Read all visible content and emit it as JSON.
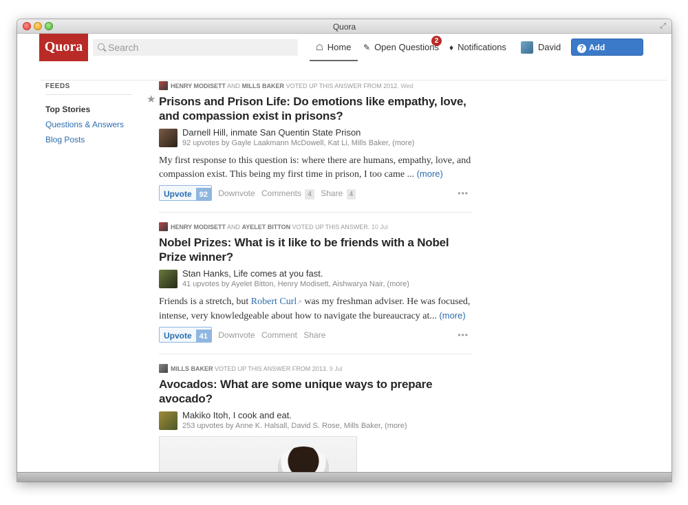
{
  "window": {
    "title": "Quora"
  },
  "header": {
    "logo": "Quora",
    "search_placeholder": "Search",
    "nav": {
      "home": "Home",
      "open_questions": "Open Questions",
      "open_questions_badge": "2",
      "notifications": "Notifications",
      "user": "David"
    },
    "add_question": "Add Question"
  },
  "sidebar": {
    "heading": "FEEDS",
    "items": [
      {
        "label": "Top Stories"
      },
      {
        "label": "Questions & Answers"
      },
      {
        "label": "Blog Posts"
      }
    ]
  },
  "stories": [
    {
      "meta_names": "HENRY MODISETT",
      "meta_and": "AND",
      "meta_names2": "MILLS BAKER",
      "meta_action": "VOTED UP THIS ANSWER FROM 2012.",
      "meta_date": "Wed",
      "title": "Prisons and Prison Life: Do emotions like empathy, love, and compassion exist in prisons?",
      "author": "Darnell Hill, inmate San Quentin State Prison",
      "upvoters": "92 upvotes by Gayle Laakmann McDowell, Kat Li, Mills Baker, (more)",
      "answer": "My first response to this question is: where there are humans, empathy, love, and compassion exist. This being my first time in prison, I too came ...",
      "more": "(more)",
      "upvote_label": "Upvote",
      "upvote_count": "92",
      "downvote": "Downvote",
      "comments": "Comments",
      "comments_count": "4",
      "share": "Share",
      "share_count": "4",
      "dots": "•••"
    },
    {
      "meta_names": "HENRY MODISETT",
      "meta_and": "AND",
      "meta_names2": "AYELET BITTON",
      "meta_action": "VOTED UP THIS ANSWER.",
      "meta_date": "10 Jul",
      "title": "Nobel Prizes: What is it like to be friends with a Nobel Prize winner?",
      "author": "Stan Hanks, Life comes at you fast.",
      "upvoters": "41 upvotes by Ayelet Bitton, Henry Modisett, Aishwarya Nair, (more)",
      "answer_pre": "Friends is a stretch, but",
      "answer_link": "Robert Curl",
      "answer_post": "was my freshman adviser. He was focused, intense, very knowledgeable about how to navigate the bureaucracy at...",
      "more": "(more)",
      "upvote_label": "Upvote",
      "upvote_count": "41",
      "downvote": "Downvote",
      "comments": "Comment",
      "share": "Share",
      "dots": "•••"
    },
    {
      "meta_names": "MILLS BAKER",
      "meta_action": "VOTED UP THIS ANSWER FROM 2013.",
      "meta_date": "9 Jul",
      "title": "Avocados: What are some unique ways to prepare avocado?",
      "author": "Makiko Itoh, I cook and eat.",
      "upvoters": "253 upvotes by Anne K. Halsall, David S. Rose, Mills Baker, (more)"
    }
  ],
  "icons": {
    "star": "★",
    "home": "⌂",
    "pencil": "✎",
    "bell": "🔔",
    "fullscreen": "⤢"
  }
}
